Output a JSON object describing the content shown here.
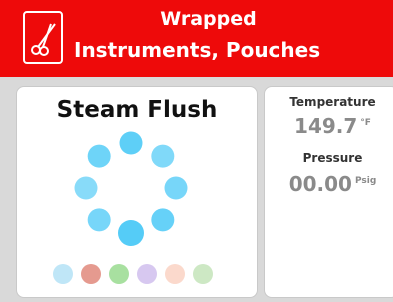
{
  "header": {
    "title_line1": "Wrapped",
    "title_line2": "Instruments, Pouches",
    "icon": "scissors-icon",
    "bg_color": "#ee0a0a"
  },
  "status": {
    "title": "Steam Flush",
    "spinner_color": "#55ccf7",
    "step_dot_colors": [
      "#bfe6f7",
      "#e59a8f",
      "#a8e0a0",
      "#d7c8f0",
      "#fbd9cc",
      "#cde8c4"
    ]
  },
  "readings": {
    "temperature": {
      "label": "Temperature",
      "value": "149.7",
      "unit": "°F"
    },
    "pressure": {
      "label": "Pressure",
      "value": "00.00",
      "unit": "Psig"
    }
  }
}
